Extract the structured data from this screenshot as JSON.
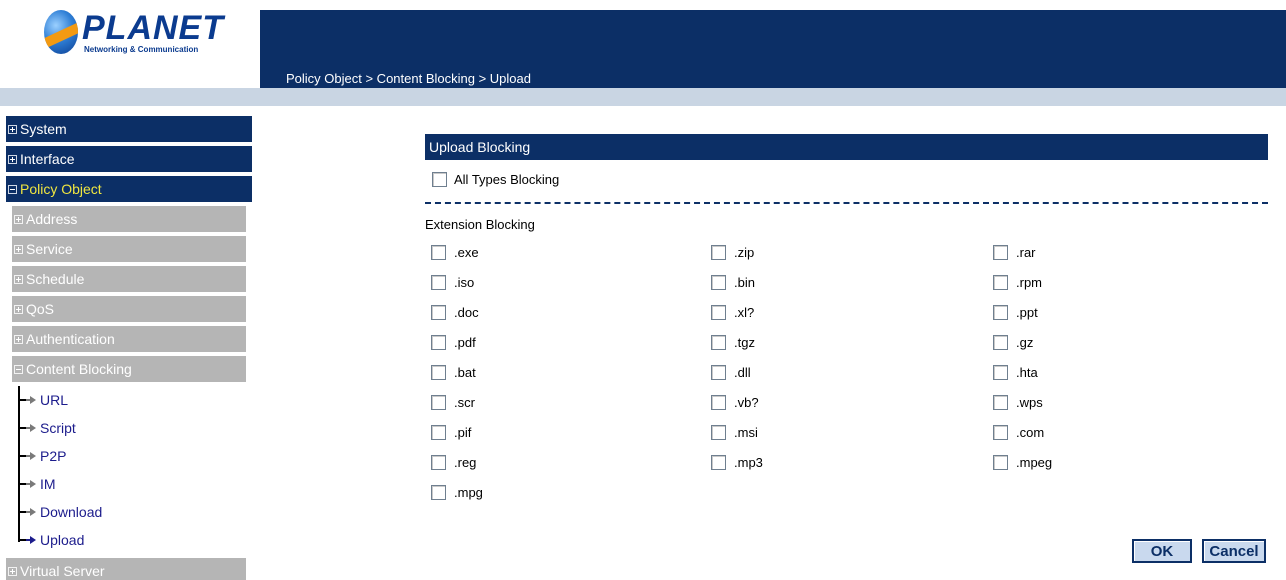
{
  "logo": {
    "name": "PLANET",
    "tagline": "Networking & Communication"
  },
  "breadcrumb": "Policy Object > Content Blocking > Upload",
  "sidebar": {
    "main_top": [
      {
        "label": "System"
      },
      {
        "label": "Interface"
      },
      {
        "label": "Policy Object"
      }
    ],
    "sub": [
      {
        "label": "Address"
      },
      {
        "label": "Service"
      },
      {
        "label": "Schedule"
      },
      {
        "label": "QoS"
      },
      {
        "label": "Authentication"
      },
      {
        "label": "Content Blocking"
      }
    ],
    "leaves": [
      {
        "label": "URL"
      },
      {
        "label": "Script"
      },
      {
        "label": "P2P"
      },
      {
        "label": "IM"
      },
      {
        "label": "Download"
      },
      {
        "label": "Upload"
      }
    ],
    "main_bottom": [
      {
        "label": "Virtual Server"
      }
    ]
  },
  "panel": {
    "title": "Upload Blocking",
    "all_types_label": "All Types Blocking",
    "extension_title": "Extension Blocking",
    "extensions": [
      [
        ".exe",
        ".zip",
        ".rar"
      ],
      [
        ".iso",
        ".bin",
        ".rpm"
      ],
      [
        ".doc",
        ".xl?",
        ".ppt"
      ],
      [
        ".pdf",
        ".tgz",
        ".gz"
      ],
      [
        ".bat",
        ".dll",
        ".hta"
      ],
      [
        ".scr",
        ".vb?",
        ".wps"
      ],
      [
        ".pif",
        ".msi",
        ".com"
      ],
      [
        ".reg",
        ".mp3",
        ".mpeg"
      ],
      [
        ".mpg"
      ]
    ]
  },
  "buttons": {
    "ok": "OK",
    "cancel": "Cancel"
  },
  "colors": {
    "navy": "#0c2f66",
    "submenu_gray": "#b5b5b5",
    "active_yellow": "#f0e640",
    "link_blue": "#1c1c8c"
  }
}
